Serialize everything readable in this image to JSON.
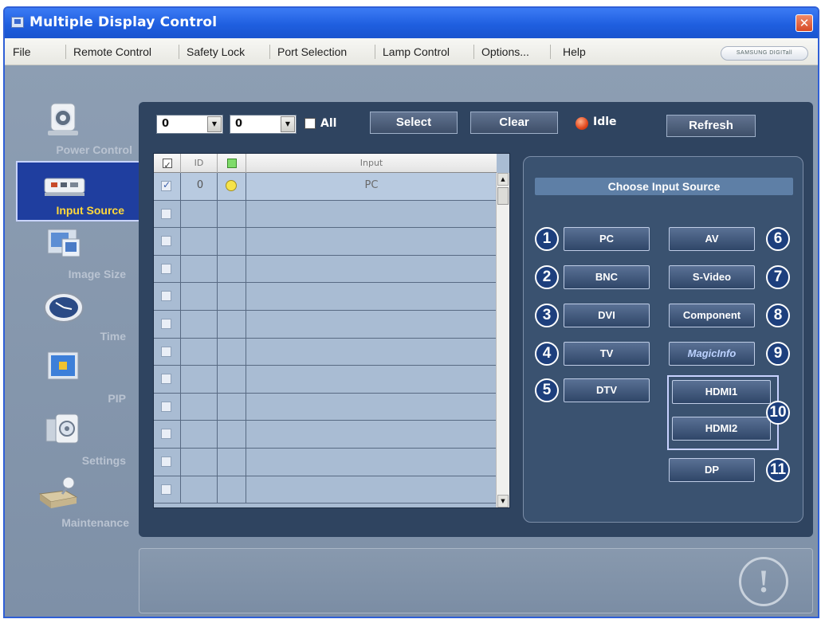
{
  "window": {
    "title": "Multiple Display Control"
  },
  "menu": {
    "items": [
      "File",
      "Remote Control",
      "Safety Lock",
      "Port Selection",
      "Lamp Control",
      "Options...",
      "Help"
    ]
  },
  "brand": "SAMSUNG DIGITall",
  "nav": {
    "items": [
      {
        "label": "Power Control",
        "icon": "power-control-icon",
        "active": false
      },
      {
        "label": "Input Source",
        "icon": "input-source-icon",
        "active": true
      },
      {
        "label": "Image Size",
        "icon": "image-size-icon",
        "active": false
      },
      {
        "label": "Time",
        "icon": "clock-icon",
        "active": false
      },
      {
        "label": "PIP",
        "icon": "pip-icon",
        "active": false
      },
      {
        "label": "Settings",
        "icon": "settings-icon",
        "active": false
      },
      {
        "label": "Maintenance",
        "icon": "maintenance-icon",
        "active": false
      }
    ]
  },
  "toolbar": {
    "combo1_value": "0",
    "combo2_value": "0",
    "all_label": "All",
    "select_label": "Select",
    "clear_label": "Clear",
    "status_label": "Idle",
    "refresh_label": "Refresh"
  },
  "grid": {
    "headers": [
      "ID",
      "Input"
    ],
    "rows": [
      {
        "checked": true,
        "id": "0",
        "status": "on",
        "input": "PC"
      },
      {
        "checked": false,
        "id": "",
        "status": "",
        "input": ""
      },
      {
        "checked": false,
        "id": "",
        "status": "",
        "input": ""
      },
      {
        "checked": false,
        "id": "",
        "status": "",
        "input": ""
      },
      {
        "checked": false,
        "id": "",
        "status": "",
        "input": ""
      },
      {
        "checked": false,
        "id": "",
        "status": "",
        "input": ""
      },
      {
        "checked": false,
        "id": "",
        "status": "",
        "input": ""
      },
      {
        "checked": false,
        "id": "",
        "status": "",
        "input": ""
      },
      {
        "checked": false,
        "id": "",
        "status": "",
        "input": ""
      },
      {
        "checked": false,
        "id": "",
        "status": "",
        "input": ""
      },
      {
        "checked": false,
        "id": "",
        "status": "",
        "input": ""
      },
      {
        "checked": false,
        "id": "",
        "status": "",
        "input": ""
      }
    ]
  },
  "source_panel": {
    "title": "Choose Input Source",
    "buttons": [
      {
        "num": "1",
        "label": "PC"
      },
      {
        "num": "2",
        "label": "BNC"
      },
      {
        "num": "3",
        "label": "DVI"
      },
      {
        "num": "4",
        "label": "TV"
      },
      {
        "num": "5",
        "label": "DTV"
      },
      {
        "num": "6",
        "label": "AV"
      },
      {
        "num": "7",
        "label": "S-Video"
      },
      {
        "num": "8",
        "label": "Component"
      },
      {
        "num": "9",
        "label": "MagicInfo"
      },
      {
        "num": "10",
        "label": "HDMI1"
      },
      {
        "num": "10",
        "label": "HDMI2"
      },
      {
        "num": "11",
        "label": "DP"
      }
    ]
  },
  "colors": {
    "titlebar": "#1f5fe0",
    "panel": "#2f4460",
    "active_nav": "#1f3e9f",
    "active_label": "#ffd83a",
    "idle_indicator": "#e3471c"
  }
}
